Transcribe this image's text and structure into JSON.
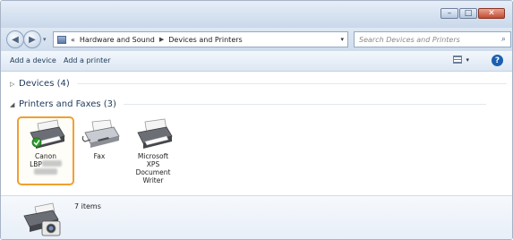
{
  "navigation": {
    "breadcrumb": [
      "Hardware and Sound",
      "Devices and Printers"
    ],
    "overflow_marker": "«",
    "search_placeholder": "Search Devices and Printers"
  },
  "toolbar": {
    "add_device_label": "Add a device",
    "add_printer_label": "Add a printer"
  },
  "groups": {
    "devices": {
      "label": "Devices (4)",
      "expanded": false
    },
    "printers": {
      "label": "Printers and Faxes (3)",
      "expanded": true
    }
  },
  "printers": [
    {
      "line1": "Canon",
      "line2": "LBP",
      "redacted": true,
      "selected": true,
      "default": true,
      "icon": "printer-icon"
    },
    {
      "line1": "Fax",
      "selected": false,
      "icon": "fax-icon"
    },
    {
      "line1": "Microsoft",
      "line2": "XPS",
      "line3": "Document",
      "line4": "Writer",
      "selected": false,
      "icon": "printer-icon"
    }
  ],
  "details": {
    "count_label": "7 items",
    "icon": "devices-and-printers-icon"
  },
  "colors": {
    "selection_border": "#f0a030",
    "default_check": "#2e9d2e",
    "close_button": "#c24a31",
    "accent_text": "#1e395b"
  }
}
